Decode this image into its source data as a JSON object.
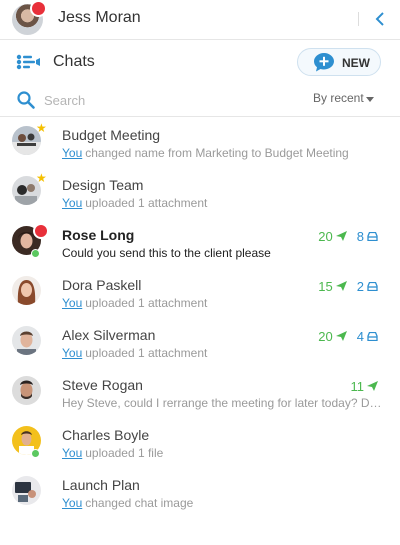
{
  "header": {
    "user_name": "Jess Moran"
  },
  "chats_bar": {
    "title": "Chats",
    "new_button_label": "NEW"
  },
  "search": {
    "placeholder": "Search",
    "sort_label": "By recent"
  },
  "you_label": "You",
  "chats": [
    {
      "name": "Budget Meeting",
      "preview": "changed name from Marketing to Budget Meeting",
      "starred": true
    },
    {
      "name": "Design Team",
      "preview": "uploaded 1 attachment",
      "starred": true
    },
    {
      "name": "Rose Long",
      "preview": "Could you send this to the client please",
      "unread": true,
      "online": true,
      "notification": true,
      "sent_count": "20",
      "files_count": "8"
    },
    {
      "name": "Dora Paskell",
      "preview": "uploaded 1 attachment",
      "sent_count": "15",
      "files_count": "2"
    },
    {
      "name": "Alex Silverman",
      "preview": "uploaded 1 attachment",
      "sent_count": "20",
      "files_count": "4"
    },
    {
      "name": "Steve Rogan",
      "preview": "Hey Steve, could I rerrange the meeting for later today? Does that work for you?",
      "sent_count": "11"
    },
    {
      "name": "Charles Boyle",
      "preview": "uploaded 1 file",
      "online": true
    },
    {
      "name": "Launch Plan",
      "preview": "changed chat image"
    }
  ],
  "colors": {
    "accent_blue": "#2e8fd0",
    "sent_green": "#4cb84f",
    "notification_red": "#e8303a",
    "star_yellow": "#f5c000",
    "online_green": "#5bc860"
  }
}
